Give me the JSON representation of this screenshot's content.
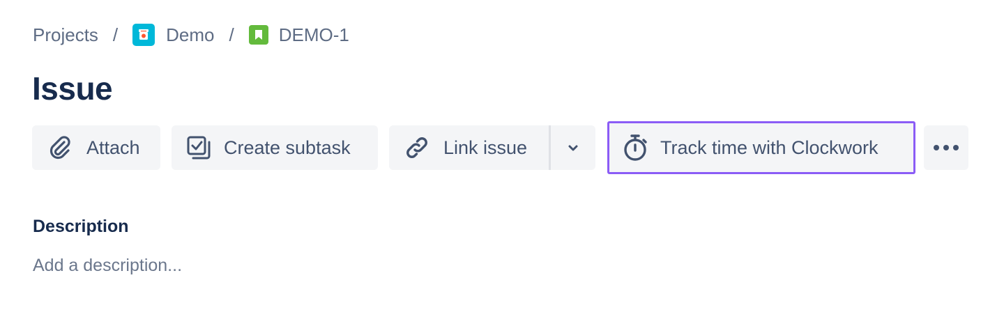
{
  "breadcrumb": {
    "projects_label": "Projects",
    "separator": "/",
    "project_label": "Demo",
    "issue_key": "DEMO-1"
  },
  "issue": {
    "title": "Issue"
  },
  "toolbar": {
    "attach_label": "Attach",
    "create_subtask_label": "Create subtask",
    "link_issue_label": "Link issue",
    "track_time_label": "Track time with Clockwork"
  },
  "description": {
    "heading": "Description",
    "placeholder": "Add a description..."
  },
  "icons": {
    "project": "project-avatar-icon",
    "issue_type": "story-icon",
    "attach": "paperclip-icon",
    "subtask": "subtask-icon",
    "link": "link-icon",
    "dropdown": "chevron-down-icon",
    "stopwatch": "stopwatch-icon",
    "more": "more-horizontal-icon"
  },
  "colors": {
    "highlight_border": "#8b5cf6",
    "project_avatar": "#00b8d9",
    "issue_type": "#63ba3c",
    "button_bg": "#f4f5f7",
    "text_primary": "#172b4d",
    "text_secondary": "#5e6c84"
  }
}
